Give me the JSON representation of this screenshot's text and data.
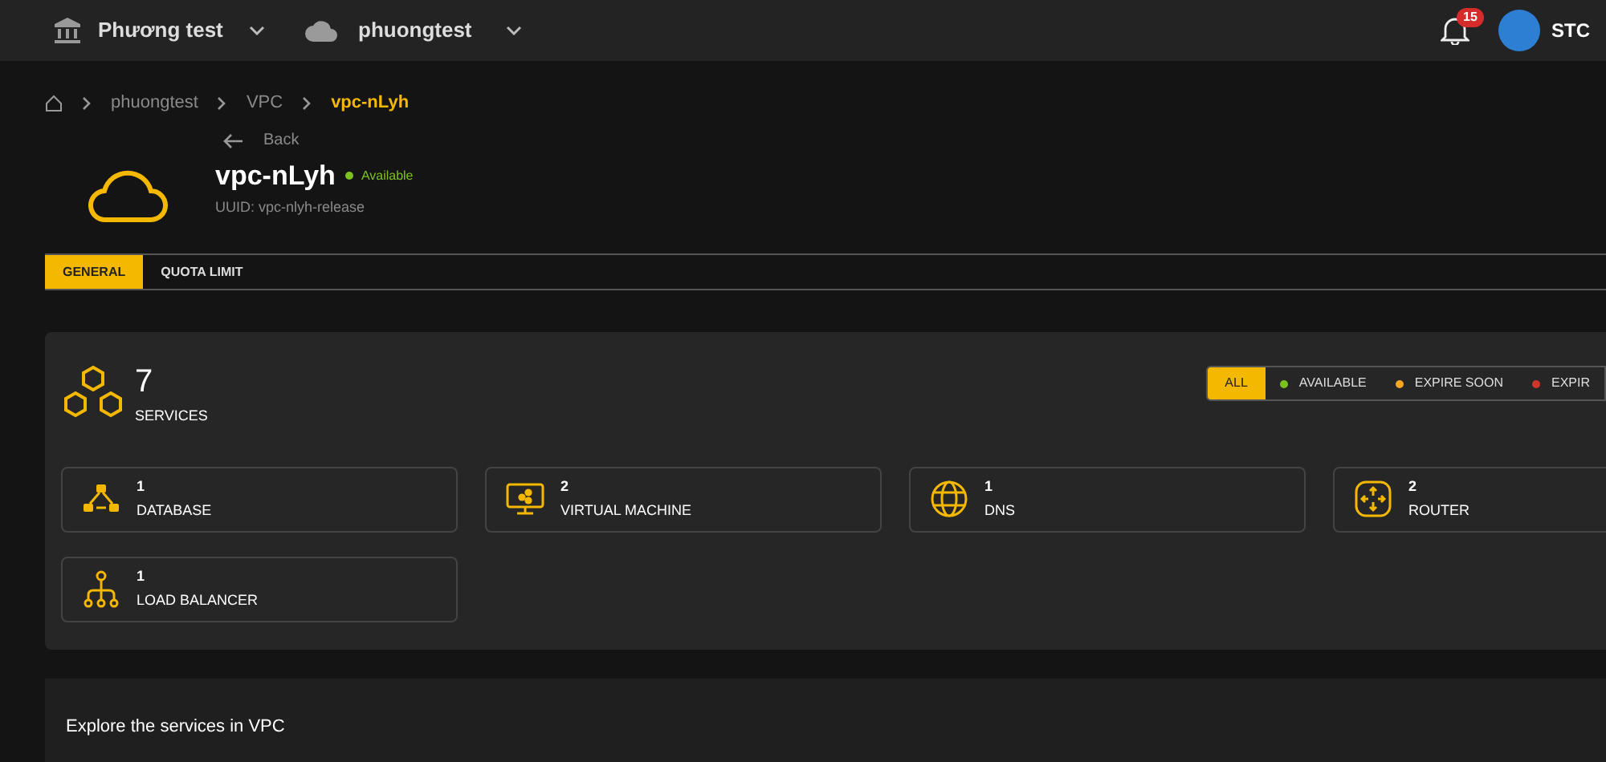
{
  "topbar": {
    "organization": "Phương test",
    "project": "phuongtest",
    "notifications": "15",
    "user": "STC"
  },
  "breadcrumb": [
    "phuongtest",
    "VPC",
    "vpc-nLyh"
  ],
  "header": {
    "back": "Back",
    "name": "vpc-nLyh",
    "status": "Available",
    "uuid": "UUID: vpc-nlyh-release"
  },
  "tabs": [
    {
      "label": "GENERAL",
      "selected": true
    },
    {
      "label": "QUOTA LIMIT",
      "selected": false
    }
  ],
  "summary": {
    "count": "7",
    "label": "SERVICES"
  },
  "filters": [
    {
      "label": "ALL",
      "selected": true
    },
    {
      "label": "AVAILABLE",
      "selected": false,
      "color": "#7cc21e"
    },
    {
      "label": "EXPIRE SOON",
      "selected": false,
      "color": "#f5a623"
    },
    {
      "label": "EXPIR",
      "selected": false,
      "color": "#d0352b"
    }
  ],
  "services": [
    {
      "kind": "database",
      "count": "1",
      "label": "DATABASE"
    },
    {
      "kind": "vm",
      "count": "2",
      "label": "VIRTUAL MACHINE"
    },
    {
      "kind": "dns",
      "count": "1",
      "label": "DNS"
    },
    {
      "kind": "router",
      "count": "2",
      "label": "ROUTER"
    },
    {
      "kind": "lb",
      "count": "1",
      "label": "LOAD BALANCER"
    }
  ],
  "explore": {
    "title": "Explore the services in VPC"
  }
}
